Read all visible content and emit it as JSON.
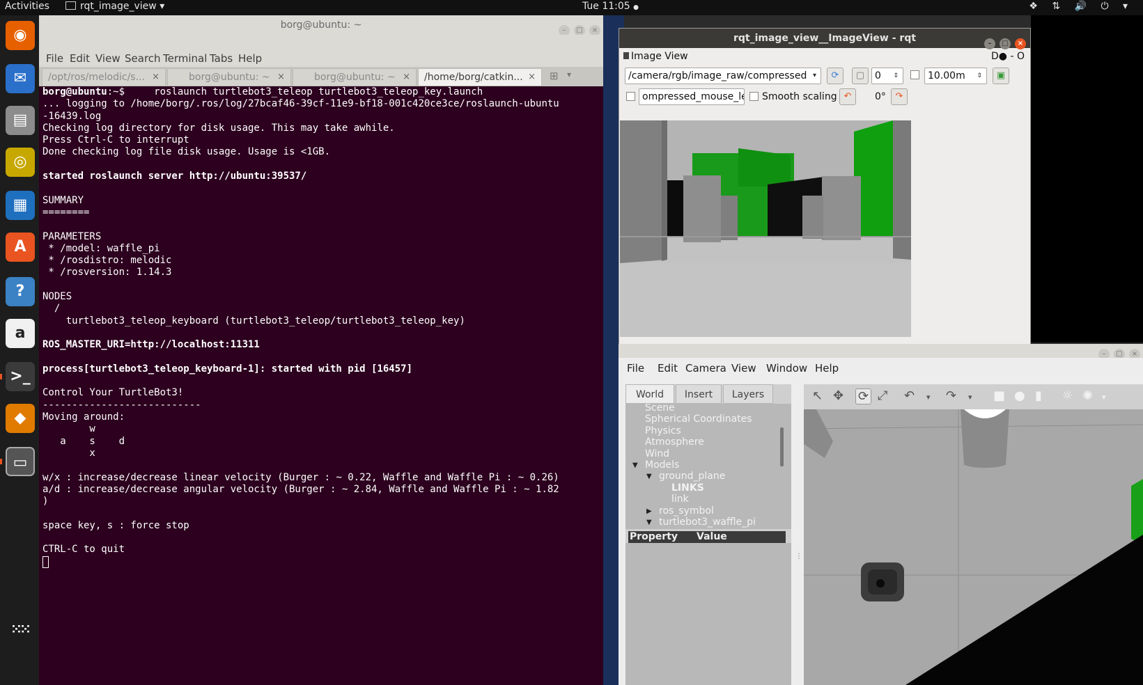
{
  "topbar": {
    "activities": "Activities",
    "app_name": "rqt_image_view",
    "app_arrow": "▾",
    "clock": "Tue 11:05",
    "clock_dot": "●",
    "tray_icons": [
      "dropbox-icon",
      "network-icon",
      "volume-icon",
      "power-icon"
    ],
    "tray": "❖ ⇅ 🔊 ⏻ ▾"
  },
  "dock": {
    "items": [
      {
        "name": "firefox-icon",
        "glyph": "◉",
        "color": "#e66000"
      },
      {
        "name": "thunderbird-icon",
        "glyph": "✉",
        "color": "#2a6fc9"
      },
      {
        "name": "files-icon",
        "glyph": "▤",
        "color": "#8c8c8c"
      },
      {
        "name": "rhythmbox-icon",
        "glyph": "◎",
        "color": "#c7a800"
      },
      {
        "name": "writer-icon",
        "glyph": "▦",
        "color": "#1f6fbf"
      },
      {
        "name": "software-center-icon",
        "glyph": "A",
        "color": "#e95420"
      },
      {
        "name": "help-icon",
        "glyph": "?",
        "color": "#3b82c4"
      },
      {
        "name": "amazon-icon",
        "glyph": "a",
        "color": "#f0f0f0"
      },
      {
        "name": "terminal-icon",
        "glyph": ">_",
        "color": "#3a3a3a"
      },
      {
        "name": "gazebo-icon",
        "glyph": "◆",
        "color": "#e07b00"
      },
      {
        "name": "rqt-window-icon",
        "glyph": "▭",
        "color": "#555555"
      }
    ],
    "apps_grid_glyph": "⁙⁙"
  },
  "terminal": {
    "title": "borg@ubuntu: ~",
    "menu": [
      "File",
      "Edit",
      "View",
      "Search",
      "Terminal",
      "Tabs",
      "Help"
    ],
    "tabs": [
      {
        "label": "/opt/ros/melodic/s...",
        "active": false
      },
      {
        "label": "borg@ubuntu: ~",
        "active": false
      },
      {
        "label": "borg@ubuntu: ~",
        "active": false
      },
      {
        "label": "/home/borg/catkin...",
        "active": true
      }
    ],
    "tab_close": "×",
    "prompt_user": "borg@ubuntu",
    "prompt_rest": ":~$     roslaunch turtlebot3_teleop turtlebot3_teleop_key.launch",
    "lines": [
      "... logging to /home/borg/.ros/log/27bcaf46-39cf-11e9-bf18-001c420ce3ce/roslaunch-ubuntu",
      "-16439.log",
      "Checking log directory for disk usage. This may take awhile.",
      "Press Ctrl-C to interrupt",
      "Done checking log file disk usage. Usage is <1GB.",
      "",
      "started roslaunch server http://ubuntu:39537/",
      "",
      "SUMMARY",
      "========",
      "",
      "PARAMETERS",
      " * /model: waffle_pi",
      " * /rosdistro: melodic",
      " * /rosversion: 1.14.3",
      "",
      "NODES",
      "  /",
      "    turtlebot3_teleop_keyboard (turtlebot3_teleop/turtlebot3_teleop_key)",
      "",
      "ROS_MASTER_URI=http://localhost:11311",
      "",
      "process[turtlebot3_teleop_keyboard-1]: started with pid [16457]",
      "",
      "Control Your TurtleBot3!",
      "---------------------------",
      "Moving around:",
      "        w",
      "   a    s    d",
      "        x",
      "",
      "w/x : increase/decrease linear velocity (Burger : ~ 0.22, Waffle and Waffle Pi : ~ 0.26)",
      "a/d : increase/decrease angular velocity (Burger : ~ 2.84, Waffle and Waffle Pi : ~ 1.82",
      ")",
      "",
      "space key, s : force stop",
      "",
      "CTRL-C to quit",
      ""
    ],
    "bold_line_indices": [
      6,
      20,
      22
    ]
  },
  "rqt": {
    "title": "rqt_image_view__ImageView - rqt",
    "dock_title": "Image View",
    "dock_right": "D● - O",
    "topic": "/camera/rgb/image_raw/compressed",
    "spin_value": "0",
    "max_range": "10.00m",
    "mouse_topic": "ompressed_mouse_left",
    "smooth_scaling_label": "Smooth scaling",
    "rotation": "0°",
    "refresh_icon": "⟳",
    "rotate_ccw_icon": "↶",
    "rotate_cw_icon": "↷",
    "save_icon": "▣",
    "zoom_icon": "▢",
    "arrow_down": "▾",
    "spin_arrows": "⇕"
  },
  "gazebo": {
    "menu": [
      "File",
      "Edit",
      "Camera",
      "View",
      "Window",
      "Help"
    ],
    "left_tabs": [
      "World",
      "Insert",
      "Layers"
    ],
    "tree": [
      {
        "label": "Scene",
        "indent": 0,
        "arrow": ""
      },
      {
        "label": "Spherical Coordinates",
        "indent": 0,
        "arrow": ""
      },
      {
        "label": "Physics",
        "indent": 0,
        "arrow": ""
      },
      {
        "label": "Atmosphere",
        "indent": 0,
        "arrow": ""
      },
      {
        "label": "Wind",
        "indent": 0,
        "arrow": ""
      },
      {
        "label": "Models",
        "indent": 0,
        "arrow": "▼"
      },
      {
        "label": "ground_plane",
        "indent": 1,
        "arrow": "▼"
      },
      {
        "label": "LINKS",
        "indent": 2,
        "arrow": "",
        "bold": true
      },
      {
        "label": "link",
        "indent": 2,
        "arrow": ""
      },
      {
        "label": "ros_symbol",
        "indent": 1,
        "arrow": "▶"
      },
      {
        "label": "turtlebot3_waffle_pi",
        "indent": 1,
        "arrow": "▼"
      }
    ],
    "prop_header": "Property",
    "value_header": "Value",
    "toolbar_icons": [
      "select-arrow-icon",
      "translate-icon",
      "rotate-icon",
      "scale-icon",
      "undo-icon",
      "redo-icon",
      "box-shape-icon",
      "sphere-shape-icon",
      "cylinder-shape-icon",
      "sun-light-icon",
      "spot-light-icon"
    ],
    "toolbar_glyphs": [
      "↖",
      "✥",
      "⟳",
      "⤢",
      "↶",
      "▾",
      "↷",
      "▾",
      "■",
      "●",
      "▮",
      "☼",
      "✺",
      "▾"
    ]
  }
}
